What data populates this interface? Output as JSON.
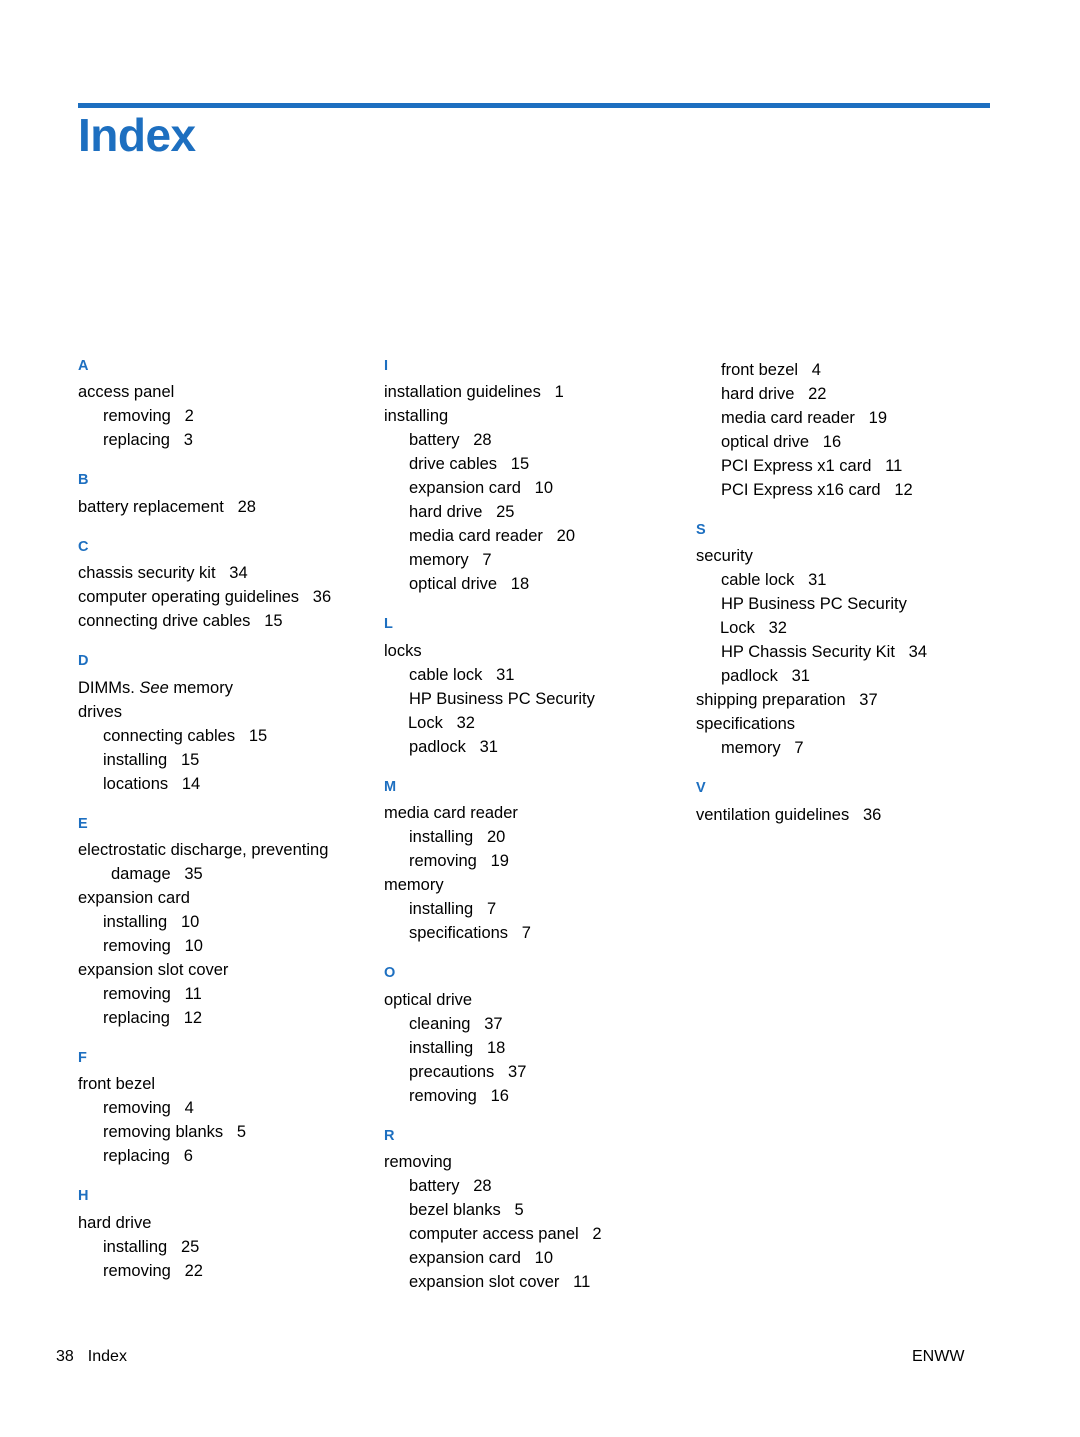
{
  "page": {
    "title": "Index",
    "accent_color": "#1d6fc0",
    "footer": {
      "page_number": "38",
      "section": "Index",
      "right": "ENWW"
    }
  },
  "columns": [
    {
      "groups": [
        {
          "letter": "A",
          "entries": [
            {
              "level": 0,
              "text": "access panel"
            },
            {
              "level": 1,
              "text": "removing   2"
            },
            {
              "level": 1,
              "text": "replacing   3"
            }
          ]
        },
        {
          "letter": "B",
          "entries": [
            {
              "level": 0,
              "text": "battery replacement   28"
            }
          ]
        },
        {
          "letter": "C",
          "entries": [
            {
              "level": 0,
              "text": "chassis security kit   34"
            },
            {
              "level": 0,
              "text": "computer operating guidelines   36"
            },
            {
              "level": 0,
              "text": "connecting drive cables   15"
            }
          ]
        },
        {
          "letter": "D",
          "entries": [
            {
              "level": 0,
              "text": "DIMMs. See memory",
              "italic_part": "See"
            },
            {
              "level": 0,
              "text": "drives"
            },
            {
              "level": 1,
              "text": "connecting cables   15"
            },
            {
              "level": 1,
              "text": "installing   15"
            },
            {
              "level": 1,
              "text": "locations   14"
            }
          ]
        },
        {
          "letter": "E",
          "entries": [
            {
              "level": 0,
              "text": "electrostatic discharge, preventing"
            },
            {
              "level": 3,
              "text": "damage   35"
            },
            {
              "level": 0,
              "text": "expansion card"
            },
            {
              "level": 1,
              "text": "installing   10"
            },
            {
              "level": 1,
              "text": "removing   10"
            },
            {
              "level": 0,
              "text": "expansion slot cover"
            },
            {
              "level": 1,
              "text": "removing   11"
            },
            {
              "level": 1,
              "text": "replacing   12"
            }
          ]
        },
        {
          "letter": "F",
          "entries": [
            {
              "level": 0,
              "text": "front bezel"
            },
            {
              "level": 1,
              "text": "removing   4"
            },
            {
              "level": 1,
              "text": "removing blanks   5"
            },
            {
              "level": 1,
              "text": "replacing   6"
            }
          ]
        },
        {
          "letter": "H",
          "entries": [
            {
              "level": 0,
              "text": "hard drive"
            },
            {
              "level": 1,
              "text": "installing   25"
            },
            {
              "level": 1,
              "text": "removing   22"
            }
          ]
        }
      ]
    },
    {
      "groups": [
        {
          "letter": "I",
          "entries": [
            {
              "level": 0,
              "text": "installation guidelines   1"
            },
            {
              "level": 0,
              "text": "installing"
            },
            {
              "level": 1,
              "text": "battery   28"
            },
            {
              "level": 1,
              "text": "drive cables   15"
            },
            {
              "level": 1,
              "text": "expansion card   10"
            },
            {
              "level": 1,
              "text": "hard drive   25"
            },
            {
              "level": 1,
              "text": "media card reader   20"
            },
            {
              "level": 1,
              "text": "memory   7"
            },
            {
              "level": 1,
              "text": "optical drive   18"
            }
          ]
        },
        {
          "letter": "L",
          "entries": [
            {
              "level": 0,
              "text": "locks"
            },
            {
              "level": 1,
              "text": "cable lock   31"
            },
            {
              "level": 1,
              "text": "HP Business PC Security"
            },
            {
              "level": 4,
              "text": "Lock   32"
            },
            {
              "level": 1,
              "text": "padlock   31"
            }
          ]
        },
        {
          "letter": "M",
          "entries": [
            {
              "level": 0,
              "text": "media card reader"
            },
            {
              "level": 1,
              "text": "installing   20"
            },
            {
              "level": 1,
              "text": "removing   19"
            },
            {
              "level": 0,
              "text": "memory"
            },
            {
              "level": 1,
              "text": "installing   7"
            },
            {
              "level": 1,
              "text": "specifications   7"
            }
          ]
        },
        {
          "letter": "O",
          "entries": [
            {
              "level": 0,
              "text": "optical drive"
            },
            {
              "level": 1,
              "text": "cleaning   37"
            },
            {
              "level": 1,
              "text": "installing   18"
            },
            {
              "level": 1,
              "text": "precautions   37"
            },
            {
              "level": 1,
              "text": "removing   16"
            }
          ]
        },
        {
          "letter": "R",
          "entries": [
            {
              "level": 0,
              "text": "removing"
            },
            {
              "level": 1,
              "text": "battery   28"
            },
            {
              "level": 1,
              "text": "bezel blanks   5"
            },
            {
              "level": 1,
              "text": "computer access panel   2"
            },
            {
              "level": 1,
              "text": "expansion card   10"
            },
            {
              "level": 1,
              "text": "expansion slot cover   11"
            }
          ]
        }
      ]
    },
    {
      "groups": [
        {
          "letter": "",
          "entries": [
            {
              "level": 1,
              "text": "front bezel   4"
            },
            {
              "level": 1,
              "text": "hard drive   22"
            },
            {
              "level": 1,
              "text": "media card reader   19"
            },
            {
              "level": 1,
              "text": "optical drive   16"
            },
            {
              "level": 1,
              "text": "PCI Express x1 card   11"
            },
            {
              "level": 1,
              "text": "PCI Express x16 card   12"
            }
          ]
        },
        {
          "letter": "S",
          "entries": [
            {
              "level": 0,
              "text": "security"
            },
            {
              "level": 1,
              "text": "cable lock   31"
            },
            {
              "level": 1,
              "text": "HP Business PC Security"
            },
            {
              "level": 4,
              "text": "Lock   32"
            },
            {
              "level": 1,
              "text": "HP Chassis Security Kit   34"
            },
            {
              "level": 1,
              "text": "padlock   31"
            },
            {
              "level": 0,
              "text": "shipping preparation   37"
            },
            {
              "level": 0,
              "text": "specifications"
            },
            {
              "level": 1,
              "text": "memory   7"
            }
          ]
        },
        {
          "letter": "V",
          "entries": [
            {
              "level": 0,
              "text": "ventilation guidelines   36"
            }
          ]
        }
      ]
    }
  ]
}
